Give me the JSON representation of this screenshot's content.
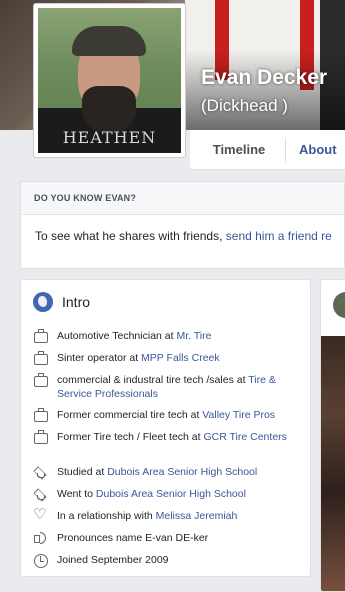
{
  "profile": {
    "name": "Evan Decker",
    "nickname": "(Dickhead )",
    "photo_text": "HEATHEN"
  },
  "tabs": {
    "timeline": "Timeline",
    "about": "About"
  },
  "know_card": {
    "heading": "DO YOU KNOW EVAN?",
    "text": "To see what he shares with friends, ",
    "link": "send him a friend re"
  },
  "intro": {
    "title": "Intro",
    "items": [
      {
        "icon": "briefcase-icon",
        "text": "Automotive Technician at ",
        "link": "Mr. Tire"
      },
      {
        "icon": "briefcase-icon",
        "text": "Sinter operator at ",
        "link": "MPP Falls Creek"
      },
      {
        "icon": "briefcase-icon",
        "text": "commercial & industral tire tech /sales at ",
        "link": "Tire & Service Professionals"
      },
      {
        "icon": "briefcase-icon",
        "text": "Former commercial tire tech at ",
        "link": "Valley Tire Pros"
      },
      {
        "icon": "briefcase-icon",
        "text": "Former Tire tech / Fleet tech at ",
        "link": "GCR Tire Centers"
      },
      {
        "icon": "graduation-cap-icon",
        "text": "Studied at ",
        "link": "Dubois Area Senior High School"
      },
      {
        "icon": "graduation-cap-icon",
        "text": "Went to ",
        "link": "Dubois Area Senior High School"
      },
      {
        "icon": "heart-icon",
        "text": "In a relationship with ",
        "link": "Melissa Jeremiah"
      },
      {
        "icon": "speaker-icon",
        "text": "Pronounces name E-van DE-ker",
        "link": ""
      },
      {
        "icon": "clock-icon",
        "text": "Joined September 2009",
        "link": ""
      }
    ]
  },
  "colors": {
    "link": "#385898",
    "background": "#e9ebee",
    "accent": "#4267b2"
  }
}
